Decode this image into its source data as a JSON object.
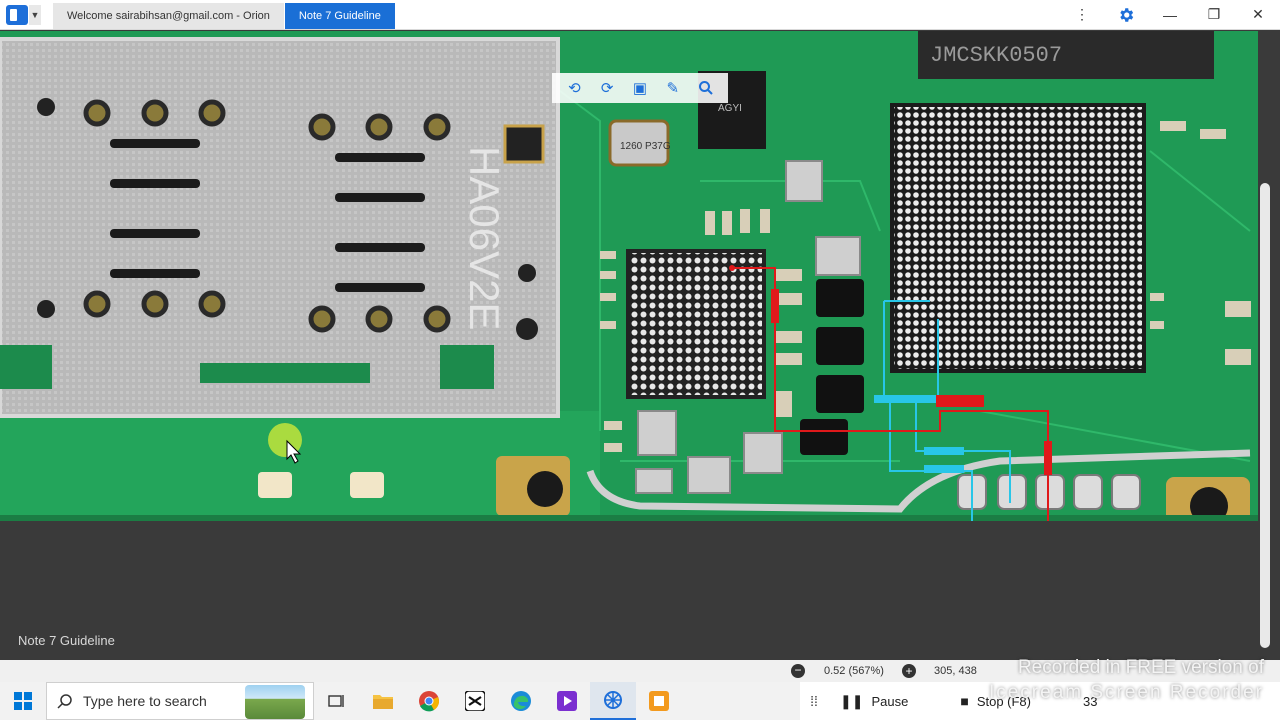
{
  "titlebar": {
    "tabs": [
      {
        "label": "Welcome sairabihsan@gmail.com - Orion",
        "active": false
      },
      {
        "label": "Note 7 Guideline",
        "active": true
      }
    ],
    "controls": {
      "more": "⋮",
      "settings_icon": "gear-icon",
      "minimize": "—",
      "restore": "❐",
      "close": "✕"
    }
  },
  "viewer": {
    "label": "Note 7 Guideline",
    "toolbar_icons": [
      "rotate-left-icon",
      "rotate-right-icon",
      "fit-screen-icon",
      "draw-tool-icon",
      "search-icon"
    ],
    "board_markings": {
      "chip_top": "JMCSKK0507",
      "shield_text": "HA06V2E",
      "crystal": "1260 P37G",
      "ic_small": "AGYI"
    }
  },
  "statusbar": {
    "zoom_out": "−",
    "zoom": "0.52 (567%)",
    "zoom_in": "+",
    "coords": "305, 438"
  },
  "taskbar": {
    "search_placeholder": "Type here to search",
    "apps": [
      "task-view-icon",
      "file-explorer-icon",
      "chrome-icon",
      "capcut-icon",
      "edge-icon",
      "video-app-icon",
      "settings-app-icon",
      "orion-icon"
    ],
    "recorder": {
      "pause": "Pause",
      "stop": "Stop (F8)",
      "time": "33"
    }
  },
  "watermark": {
    "line1": "Recorded in FREE version of",
    "line2": "Icecream Screen Recorder"
  },
  "colors": {
    "accent": "#1a6fd6",
    "pcb_green": "#1f9a55",
    "trace_red": "#e0191b",
    "trace_cyan": "#28c6e8"
  }
}
